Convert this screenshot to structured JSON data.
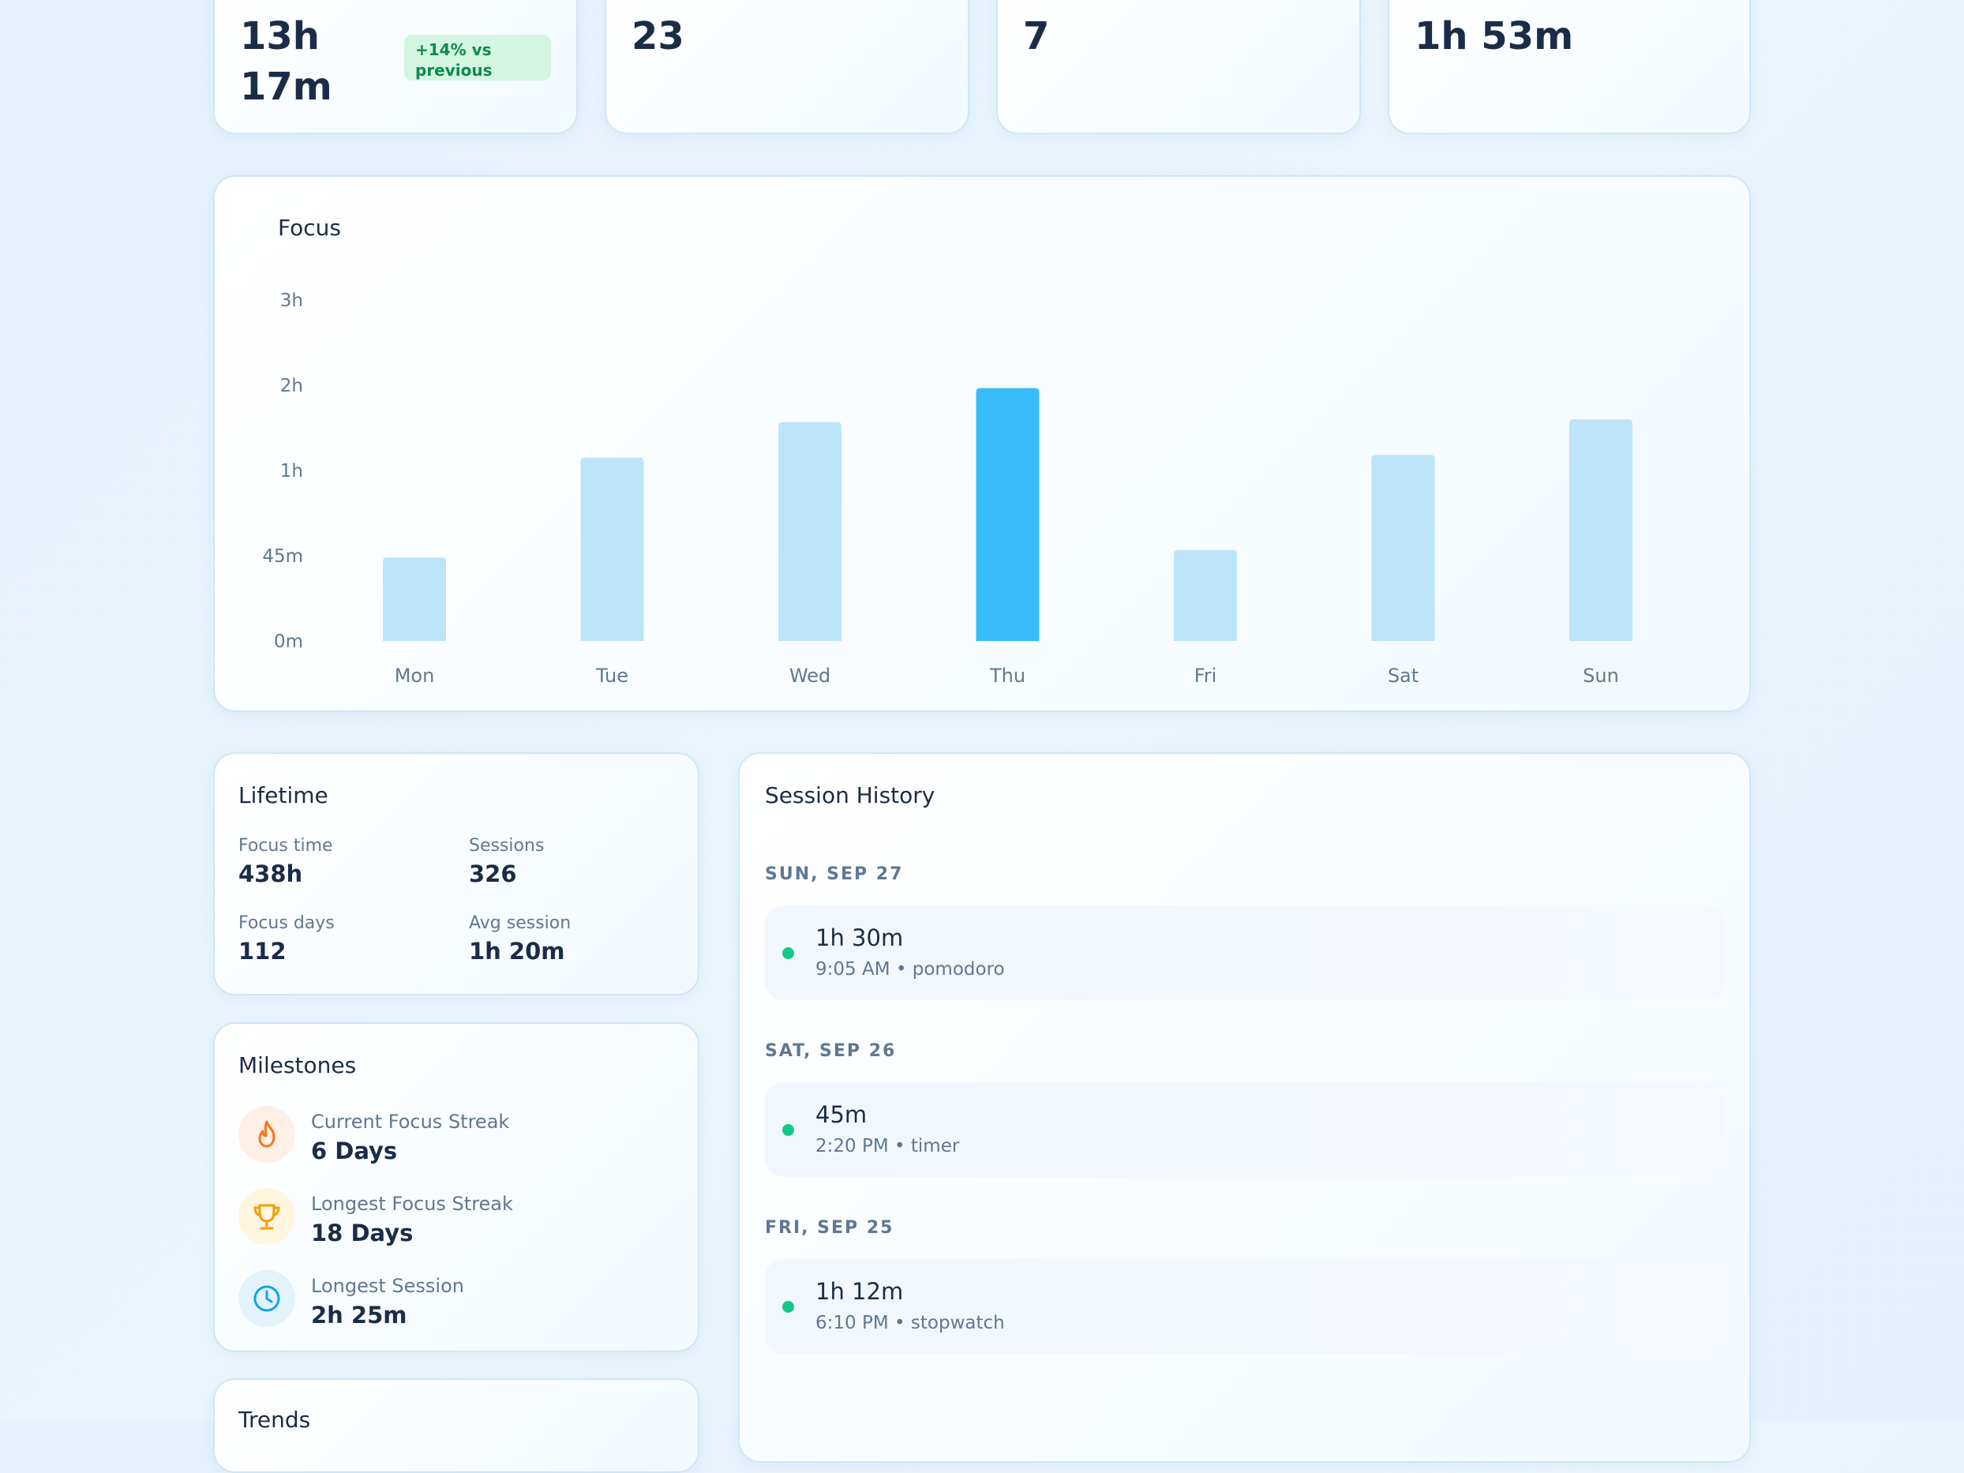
{
  "stats": [
    {
      "value": "13h\n17m",
      "badge": "+14% vs previous"
    },
    {
      "value": "23"
    },
    {
      "value": "7"
    },
    {
      "value": "1h 53m"
    }
  ],
  "focus_chart": {
    "title": "Focus",
    "highlight_color": "#38bdf8",
    "base_color": "#bce5fa"
  },
  "chart_data": {
    "type": "bar",
    "title": "Focus",
    "categories": [
      "Mon",
      "Tue",
      "Wed",
      "Thu",
      "Fri",
      "Sat",
      "Sun"
    ],
    "values_minutes": [
      44,
      69,
      94,
      118,
      46,
      71,
      96
    ],
    "y_ticks": [
      "0m",
      "45m",
      "1h",
      "2h",
      "3h"
    ],
    "highlighted": "Thu",
    "grid": false,
    "xlabel": "",
    "ylabel": ""
  },
  "lifetime": {
    "title": "Lifetime",
    "items": [
      {
        "label": "Focus time",
        "value": "438h"
      },
      {
        "label": "Sessions",
        "value": "326"
      },
      {
        "label": "Focus days",
        "value": "112"
      },
      {
        "label": "Avg session",
        "value": "1h 20m"
      }
    ]
  },
  "milestones": {
    "title": "Milestones",
    "items": [
      {
        "icon": "flame-icon",
        "label": "Current Focus Streak",
        "value": "6 Days",
        "color": "#f97316"
      },
      {
        "icon": "trophy-icon",
        "label": "Longest Focus Streak",
        "value": "18 Days",
        "color": "#f59e0b"
      },
      {
        "icon": "clock-icon",
        "label": "Longest Session",
        "value": "2h 25m",
        "color": "#0ea5e9"
      }
    ]
  },
  "trends": {
    "title": "Trends"
  },
  "history": {
    "title": "Session History",
    "days": [
      {
        "date": "SUN, SEP 27",
        "duration": "1h 30m",
        "time": "9:05 AM",
        "mode": "pomodoro"
      },
      {
        "date": "SAT, SEP 26",
        "duration": "45m",
        "time": "2:20 PM",
        "mode": "timer"
      },
      {
        "date": "FRI, SEP 25",
        "duration": "1h 12m",
        "time": "6:10 PM",
        "mode": "stopwatch"
      }
    ],
    "separator": "•"
  }
}
